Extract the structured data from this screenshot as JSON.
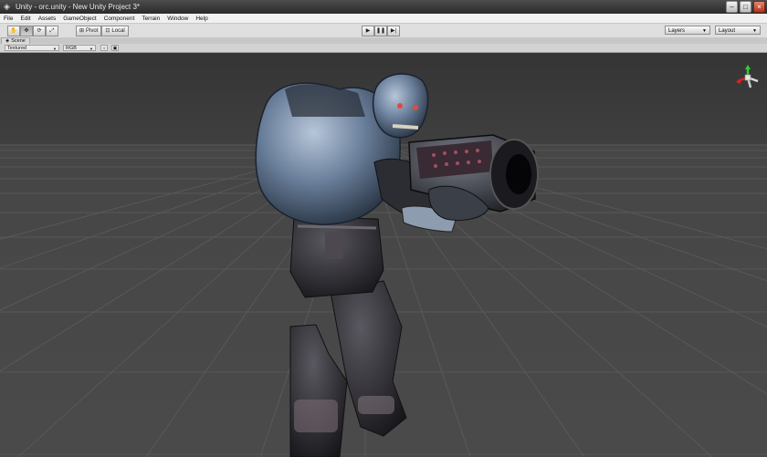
{
  "window": {
    "title": "Unity - orc.unity - New Unity Project 3*",
    "app_icon": "unity-icon",
    "controls": [
      "minimize",
      "maximize",
      "close"
    ]
  },
  "menu": [
    "File",
    "Edit",
    "Assets",
    "GameObject",
    "Component",
    "Terrain",
    "Window",
    "Help"
  ],
  "toolbar": {
    "tools": [
      "hand-tool-icon",
      "move-tool-icon",
      "rotate-tool-icon",
      "scale-tool-icon"
    ],
    "pivot_label": "Pivot",
    "local_label": "Local",
    "playback": [
      "play-icon",
      "pause-icon",
      "step-icon"
    ],
    "layers_label": "Layers",
    "layout_label": "Layout"
  },
  "scene": {
    "tab_label": "Scene",
    "render_mode": "Textured",
    "color_mode": "RGB"
  },
  "colors": {
    "viewport_bg": "#414141",
    "sky": "#3b3b3b",
    "grid": "#5a5a5a",
    "gizmo_x": "#d22",
    "gizmo_y": "#3c3",
    "gizmo_z": "#36f"
  }
}
